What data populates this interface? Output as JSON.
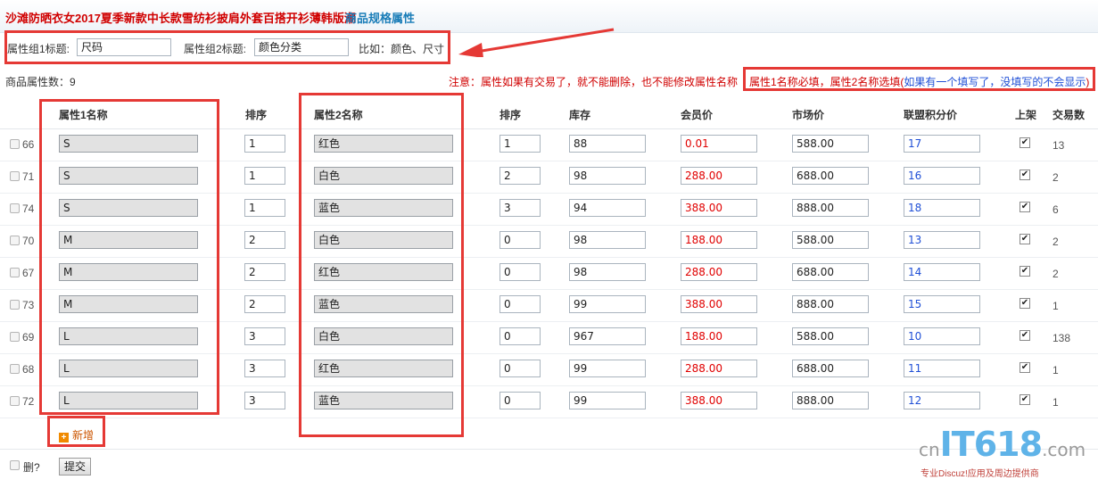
{
  "title": {
    "product": "沙滩防晒衣女2017夏季新款中长款雪纺衫披肩外套百搭开衫薄韩版潮",
    "section": "商品规格属性"
  },
  "config": {
    "group1_label": "属性组1标题:",
    "group1_value": "尺码",
    "group2_label": "属性组2标题:",
    "group2_value": "颜色分类",
    "example": "比如：颜色、尺寸"
  },
  "attr_count": "商品属性数：9",
  "notice": "注意：属性如果有交易了，就不能删除，也不能修改属性名称",
  "notice2_a": "属性1名称必填，属性2名称选填(",
  "notice2_b": "如果有一个填写了，没填写的不会显示",
  "notice2_c": ")",
  "headers": {
    "attr1": "属性1名称",
    "sort1": "排序",
    "attr2": "属性2名称",
    "sort2": "排序",
    "stock": "库存",
    "member_price": "会员价",
    "market_price": "市场价",
    "points_price": "联盟积分价",
    "on_shelf": "上架",
    "trades": "交易数"
  },
  "rows": [
    {
      "id": "66",
      "attr1": "S",
      "sort1": "1",
      "attr2": "红色",
      "sort2": "1",
      "stock": "88",
      "member_price": "0.01",
      "market_price": "588.00",
      "points_price": "17",
      "on_shelf": "✔",
      "trades": "13"
    },
    {
      "id": "71",
      "attr1": "S",
      "sort1": "1",
      "attr2": "白色",
      "sort2": "2",
      "stock": "98",
      "member_price": "288.00",
      "market_price": "688.00",
      "points_price": "16",
      "on_shelf": "✔",
      "trades": "2"
    },
    {
      "id": "74",
      "attr1": "S",
      "sort1": "1",
      "attr2": "蓝色",
      "sort2": "3",
      "stock": "94",
      "member_price": "388.00",
      "market_price": "888.00",
      "points_price": "18",
      "on_shelf": "✔",
      "trades": "6"
    },
    {
      "id": "70",
      "attr1": "M",
      "sort1": "2",
      "attr2": "白色",
      "sort2": "0",
      "stock": "98",
      "member_price": "188.00",
      "market_price": "588.00",
      "points_price": "13",
      "on_shelf": "✔",
      "trades": "2"
    },
    {
      "id": "67",
      "attr1": "M",
      "sort1": "2",
      "attr2": "红色",
      "sort2": "0",
      "stock": "98",
      "member_price": "288.00",
      "market_price": "688.00",
      "points_price": "14",
      "on_shelf": "✔",
      "trades": "2"
    },
    {
      "id": "73",
      "attr1": "M",
      "sort1": "2",
      "attr2": "蓝色",
      "sort2": "0",
      "stock": "99",
      "member_price": "388.00",
      "market_price": "888.00",
      "points_price": "15",
      "on_shelf": "✔",
      "trades": "1"
    },
    {
      "id": "69",
      "attr1": "L",
      "sort1": "3",
      "attr2": "白色",
      "sort2": "0",
      "stock": "967",
      "member_price": "188.00",
      "market_price": "588.00",
      "points_price": "10",
      "on_shelf": "✔",
      "trades": "138"
    },
    {
      "id": "68",
      "attr1": "L",
      "sort1": "3",
      "attr2": "红色",
      "sort2": "0",
      "stock": "99",
      "member_price": "288.00",
      "market_price": "688.00",
      "points_price": "11",
      "on_shelf": "✔",
      "trades": "1"
    },
    {
      "id": "72",
      "attr1": "L",
      "sort1": "3",
      "attr2": "蓝色",
      "sort2": "0",
      "stock": "99",
      "member_price": "388.00",
      "market_price": "888.00",
      "points_price": "12",
      "on_shelf": "✔",
      "trades": "1"
    }
  ],
  "add_label": "新增",
  "delete_label": "删?",
  "submit_label": "提交",
  "watermark": {
    "cn": "cn",
    "it": "IT618",
    "com": ".com",
    "tagline": "专业Discuz!应用及周边提供商"
  },
  "colors": {
    "accent_red": "#e53935",
    "price_red": "#e00000",
    "points_blue": "#1f4fd6",
    "link_blue": "#1a7db8"
  }
}
